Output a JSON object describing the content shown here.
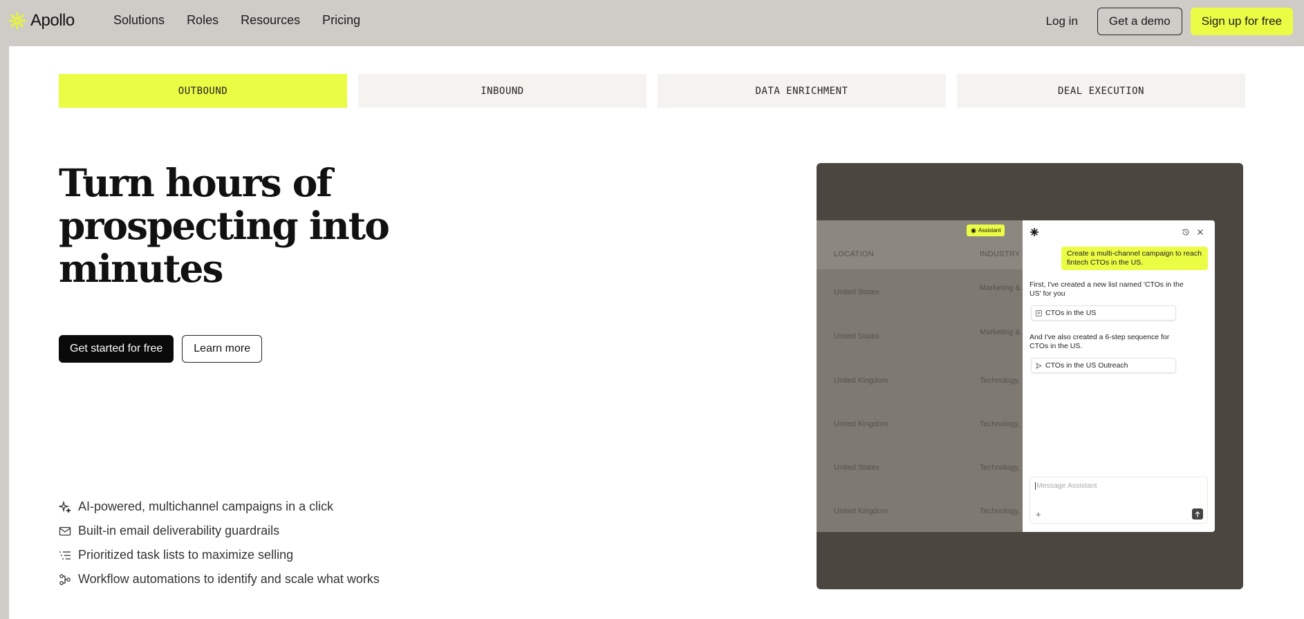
{
  "brand": {
    "name": "Apollo",
    "accent": "#ebfc45"
  },
  "nav": {
    "links": [
      "Solutions",
      "Roles",
      "Resources",
      "Pricing"
    ],
    "login": "Log in",
    "demo": "Get a demo",
    "signup": "Sign up for free"
  },
  "tabs": [
    {
      "label": "OUTBOUND",
      "active": true
    },
    {
      "label": "INBOUND",
      "active": false
    },
    {
      "label": "DATA ENRICHMENT",
      "active": false
    },
    {
      "label": "DEAL EXECUTION",
      "active": false
    }
  ],
  "hero": {
    "headline": "Turn hours of prospecting into minutes",
    "primary_cta": "Get started for free",
    "secondary_cta": "Learn more"
  },
  "features": [
    {
      "icon": "sparkle-icon",
      "text": "AI-powered, multichannel campaigns in a click"
    },
    {
      "icon": "envelope-icon",
      "text": "Built-in email deliverability guardrails"
    },
    {
      "icon": "list-priority-icon",
      "text": "Prioritized task lists to maximize selling"
    },
    {
      "icon": "workflow-icon",
      "text": "Workflow automations to identify and scale what works"
    }
  ],
  "demo": {
    "assistant_pill": "Assistant",
    "columns": [
      "LOCATION",
      "INDUSTRY"
    ],
    "rows": [
      {
        "location": "United States",
        "industry": "Marketing & Advertising"
      },
      {
        "location": "United States",
        "industry": "Marketing & Advertising"
      },
      {
        "location": "United Kingdom",
        "industry": "Technology,"
      },
      {
        "location": "United Kingdom",
        "industry": "Technology,"
      },
      {
        "location": "United States",
        "industry": "Technology,"
      },
      {
        "location": "United Kingdom",
        "industry": "Technology,"
      }
    ],
    "chat": {
      "user_message": "Create a multi-channel campaign to reach fintech CTOs in the US.",
      "reply_1": "First, I've created a new list named 'CTOs in the US' for you",
      "card_1": "CTOs in the US",
      "reply_2": "And I've also created a 6-step sequence for CTOs in the US.",
      "card_2": "CTOs in the US Outreach",
      "input_placeholder": "Message Assistant",
      "plus": "+"
    }
  }
}
